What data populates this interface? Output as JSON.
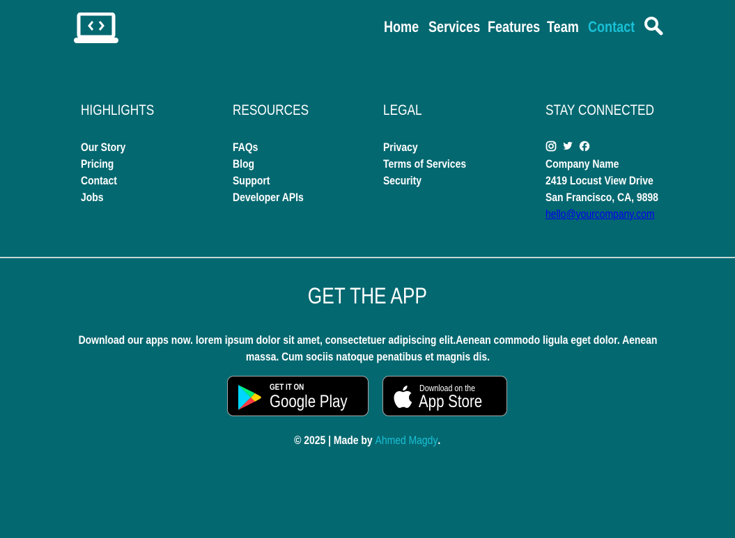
{
  "header": {
    "logo_icon": "laptop-code-icon",
    "nav": [
      {
        "label": "Home",
        "active": false
      },
      {
        "label": "Services",
        "active": false
      },
      {
        "label": "Features",
        "active": false
      },
      {
        "label": "Team",
        "active": false
      },
      {
        "label": "Contact",
        "active": true
      }
    ],
    "search_icon": "search-icon"
  },
  "footer": {
    "highlights": {
      "title": "HIGHLIGHTS",
      "links": [
        "Our Story",
        "Pricing",
        "Contact",
        "Jobs"
      ]
    },
    "resources": {
      "title": "RESOURCES",
      "links": [
        "FAQs",
        "Blog",
        "Support",
        "Developer APIs"
      ]
    },
    "legal": {
      "title": "LEGAL",
      "links": [
        "Privacy",
        "Terms of Services",
        "Security"
      ]
    },
    "connected": {
      "title": "STAY CONNECTED",
      "social_icons": [
        "instagram-icon",
        "twitter-icon",
        "facebook-icon"
      ],
      "company": "Company Name",
      "address_line1": "2419 Locust View Drive",
      "address_line2": "San Francisco, CA, 9898",
      "email": "hello@yourcompany.com"
    }
  },
  "app": {
    "title": "GET THE APP",
    "description": "Download our apps now. lorem ipsum dolor sit amet, consectetuer adipiscing elit.Aenean commodo ligula eget dolor. Aenean massa. Cum sociis natoque penatibus et magnis dis.",
    "google_play": {
      "small": "GET IT ON",
      "big": "Google Play"
    },
    "app_store": {
      "small": "Download on the",
      "big": "App Store"
    }
  },
  "copyright": {
    "prefix": "© 2025 | Made by ",
    "author": "Ahmed Magdy",
    "suffix": "."
  },
  "colors": {
    "background": "#046870",
    "accent": "#19c0d6",
    "text": "#ffffff",
    "link": "#0000ee"
  }
}
